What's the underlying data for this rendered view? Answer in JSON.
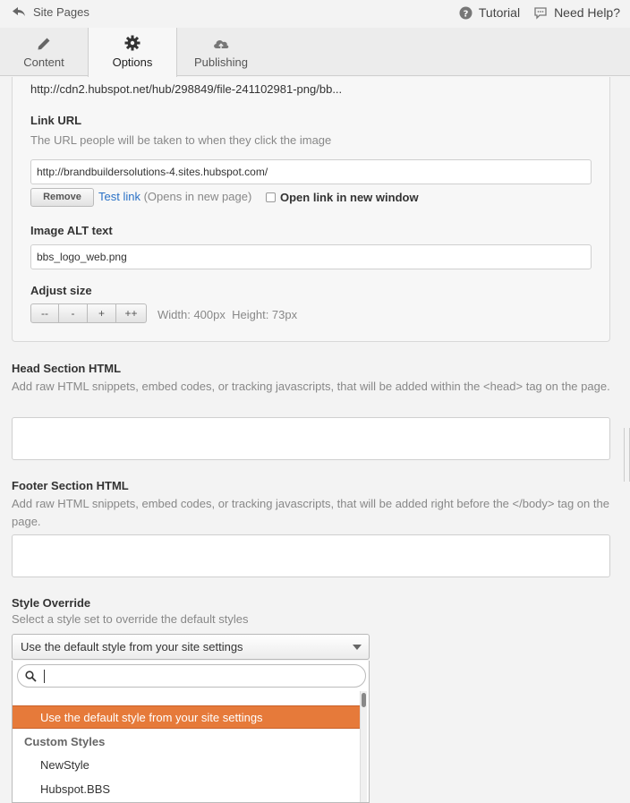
{
  "topbar": {
    "back_label": "Site Pages",
    "tutorial_label": "Tutorial",
    "help_label": "Need Help?"
  },
  "tabs": [
    {
      "label": "Content",
      "icon": "pencil-icon"
    },
    {
      "label": "Options",
      "icon": "gear-icon",
      "active": true
    },
    {
      "label": "Publishing",
      "icon": "cloud-upload-icon"
    }
  ],
  "image_module": {
    "file_url": "http://cdn2.hubspot.net/hub/298849/file-241102981-png/bb...",
    "link_url_label": "Link URL",
    "link_url_help": "The URL people will be taken to when they click the image",
    "link_url_value": "http://brandbuildersolutions-4.sites.hubspot.com/",
    "remove_label": "Remove",
    "test_link_label": "Test link",
    "test_link_note": "(Opens in new page)",
    "new_window_label": "Open link in new window",
    "alt_label": "Image ALT text",
    "alt_value": "bbs_logo_web.png",
    "size_label": "Adjust size",
    "size_buttons": [
      "--",
      "-",
      "+",
      "++"
    ],
    "width_text": "Width: 400px",
    "height_text": "Height: 73px"
  },
  "head_html": {
    "label": "Head Section HTML",
    "help": "Add raw HTML snippets, embed codes, or tracking javascripts, that will be added within the <head> tag on the page."
  },
  "footer_html": {
    "label": "Footer Section HTML",
    "help": "Add raw HTML snippets, embed codes, or tracking javascripts, that will be added right before the </body> tag on the page."
  },
  "style_override": {
    "label": "Style Override",
    "help": "Select a style set to override the default styles",
    "selected": "Use the default style from your site settings",
    "options": {
      "default": "Use the default style from your site settings",
      "group_label": "Custom Styles",
      "custom": [
        "NewStyle",
        "Hubspot.BBS"
      ]
    }
  },
  "colors": {
    "accent": "#e67a3a",
    "link": "#2a71c6"
  }
}
